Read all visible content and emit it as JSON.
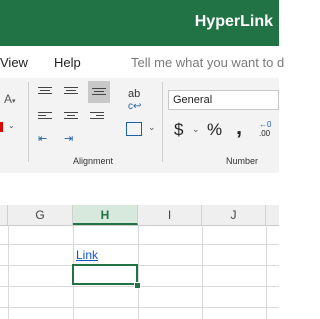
{
  "title": "HyperLink",
  "menu": {
    "view": "View",
    "help": "Help",
    "tell_me": "Tell me what you want to d"
  },
  "ribbon": {
    "font_size_glyph": "A",
    "number_format": "General",
    "currency_symbol": "$",
    "percent_symbol": "%",
    "comma_symbol": "‚",
    "decimal_increase": ".00",
    "decimal_increase_top": "←0",
    "wrap_text_glyph": "ab",
    "alignment_label": "Alignment",
    "number_label": "Number"
  },
  "columns": [
    "G",
    "H",
    "I",
    "J"
  ],
  "selected_column": "H",
  "cell_link_text": "Link",
  "colors": {
    "brand": "#217346",
    "link": "#1155cc"
  }
}
